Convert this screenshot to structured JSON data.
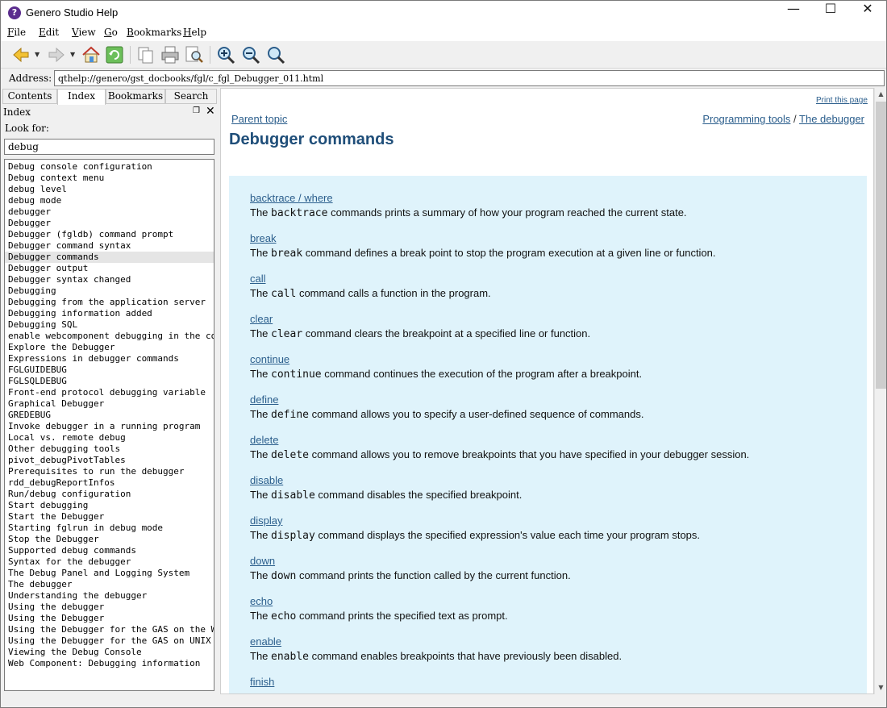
{
  "window": {
    "title": "Genero Studio Help",
    "minimize": "—",
    "maximize": "☐",
    "close": "✕"
  },
  "menubar": {
    "items": [
      {
        "underline": "F",
        "rest": "ile"
      },
      {
        "underline": "E",
        "rest": "dit"
      },
      {
        "underline": "V",
        "rest": "iew"
      },
      {
        "underline": "G",
        "rest": "o"
      },
      {
        "underline": "B",
        "rest": "ookmarks"
      },
      {
        "underline": "H",
        "rest": "elp"
      }
    ]
  },
  "toolbar": {
    "icons": [
      "back-icon",
      "forward-icon",
      "home-icon",
      "sync-icon",
      "copy-icon",
      "print-icon",
      "find-icon",
      "zoom-in-icon",
      "zoom-out-icon",
      "zoom-reset-icon"
    ]
  },
  "address": {
    "label": "Address:",
    "value": "qthelp://genero/gst_docbooks/fgl/c_fgl_Debugger_011.html"
  },
  "sidebar": {
    "tabs": [
      "Contents",
      "Index",
      "Bookmarks",
      "Search"
    ],
    "active_tab": "Index",
    "panel_title": "Index",
    "look_for_label": "Look for:",
    "search_value": "debug",
    "selected_item": "Debugger commands",
    "items": [
      "Debug console configuration",
      "Debug context menu",
      "debug level",
      "debug mode",
      "debugger",
      "Debugger",
      "Debugger (fgldb) command prompt",
      "Debugger command syntax",
      "Debugger commands",
      "Debugger output",
      "Debugger syntax changed",
      "Debugging",
      "Debugging from the application server",
      "Debugging information added",
      "Debugging SQL",
      "enable webcomponent debugging in the co…",
      "Explore the Debugger",
      "Expressions in debugger commands",
      "FGLGUIDEBUG",
      "FGLSQLDEBUG",
      "Front-end protocol debugging variable",
      "Graphical Debugger",
      "GREDEBUG",
      "Invoke debugger in a running program",
      "Local vs. remote debug",
      "Other debugging tools",
      "pivot_debugPivotTables",
      "Prerequisites to run the debugger",
      "rdd_debugReportInfos",
      "Run/debug configuration",
      "Start debugging",
      "Start the Debugger",
      "Starting fglrun in debug mode",
      "Stop the Debugger",
      "Supported debug commands",
      "Syntax for the debugger",
      "The Debug Panel and Logging System",
      "The debugger",
      "Understanding the debugger",
      "Using the debugger",
      "Using the Debugger",
      "Using the Debugger for the GAS on the W…",
      "Using the Debugger for the GAS on UNIX",
      "Viewing the Debug Console",
      "Web Component: Debugging information"
    ]
  },
  "content": {
    "print_link": "Print this page",
    "parent_link": "Parent topic",
    "breadcrumb": [
      "Programming tools",
      "The debugger"
    ],
    "breadcrumb_sep": " / ",
    "page_title": "Debugger commands",
    "commands": [
      {
        "name": "backtrace / where",
        "pre": "The ",
        "code": "backtrace",
        "post": " commands prints a summary of how your program reached the current state."
      },
      {
        "name": "break",
        "pre": "The ",
        "code": "break",
        "post": " command defines a break point to stop the program execution at a given line or function."
      },
      {
        "name": "call",
        "pre": "The ",
        "code": "call",
        "post": " command calls a function in the program."
      },
      {
        "name": "clear",
        "pre": "The ",
        "code": "clear",
        "post": " command clears the breakpoint at a specified line or function."
      },
      {
        "name": "continue",
        "pre": "The ",
        "code": "continue",
        "post": " command continues the execution of the program after a breakpoint."
      },
      {
        "name": "define",
        "pre": "The ",
        "code": "define",
        "post": " command allows you to specify a user-defined sequence of commands."
      },
      {
        "name": "delete",
        "pre": "The ",
        "code": "delete",
        "post": " command allows you to remove breakpoints that you have specified in your debugger session."
      },
      {
        "name": "disable",
        "pre": "The ",
        "code": "disable",
        "post": " command disables the specified breakpoint."
      },
      {
        "name": "display",
        "pre": "The ",
        "code": "display",
        "post": " command displays the specified expression's value each time your program stops."
      },
      {
        "name": "down",
        "pre": "The ",
        "code": "down",
        "post": " command prints the function called by the current function."
      },
      {
        "name": "echo",
        "pre": "The ",
        "code": "echo",
        "post": " command prints the specified text as prompt."
      },
      {
        "name": "enable",
        "pre": "The ",
        "code": "enable",
        "post": " command enables breakpoints that have previously been disabled."
      },
      {
        "name": "finish",
        "pre": "",
        "code": "",
        "post": ""
      }
    ]
  },
  "colors": {
    "link": "#2b5e8c",
    "title": "#1f4e79",
    "box_bg": "#dff3fb",
    "selection": "#e5e5e5"
  }
}
